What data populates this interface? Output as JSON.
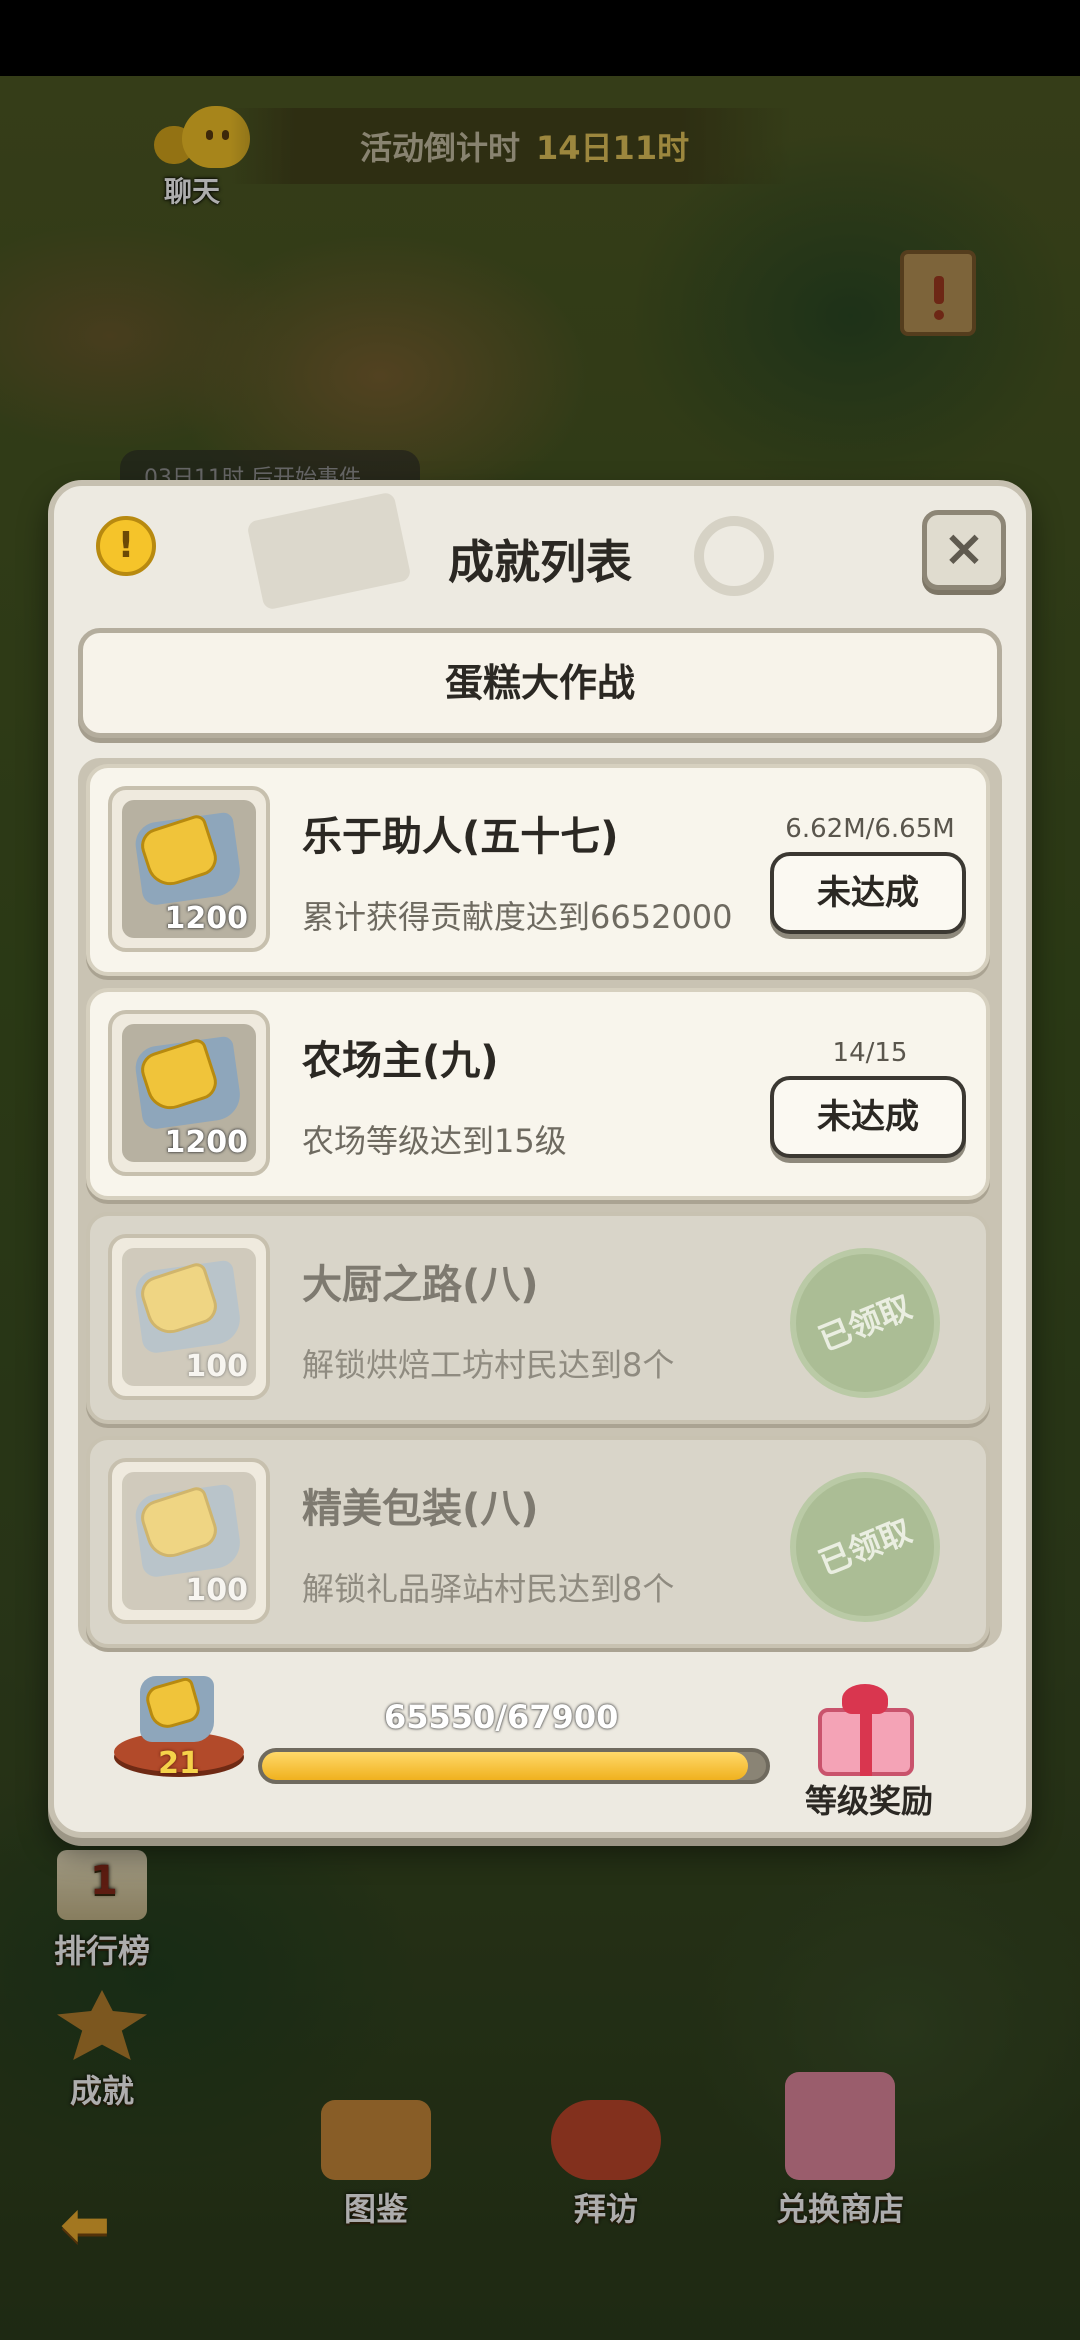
{
  "hud": {
    "chat_label": "聊天",
    "countdown_label": "活动倒计时",
    "countdown_value": "14日11时",
    "event_hint": "03日11时 后开始事件"
  },
  "side_menu": {
    "ranking_label": "排行榜",
    "ranking_icon_number": "1",
    "achievements_label": "成就"
  },
  "bottom_nav": {
    "back_icon": "arrow-left-icon",
    "catalog_label": "图鉴",
    "visit_label": "拜访",
    "shop_label": "兑换商店"
  },
  "dialog": {
    "title": "成就列表",
    "close_glyph": "×",
    "warn_glyph": "!",
    "tab_label": "蛋糕大作战",
    "achievements": [
      {
        "name": "乐于助人(五十七)",
        "desc": "累计获得贡献度达到6652000",
        "reward": "1200",
        "progress": "6.62M/6.65M",
        "status": "未达成",
        "claimed": false
      },
      {
        "name": "农场主(九)",
        "desc": "农场等级达到15级",
        "reward": "1200",
        "progress": "14/15",
        "status": "未达成",
        "claimed": false
      },
      {
        "name": "大厨之路(八)",
        "desc": "解锁烘焙工坊村民达到8个",
        "reward": "100",
        "progress": "",
        "status": "已领取",
        "claimed": true
      },
      {
        "name": "精美包装(八)",
        "desc": "解锁礼品驿站村民达到8个",
        "reward": "100",
        "progress": "",
        "status": "已领取",
        "claimed": true
      }
    ],
    "level": {
      "value": "21",
      "xp_text": "65550/67900",
      "xp_fraction": 0.965,
      "reward_label": "等级奖励"
    }
  },
  "colors": {
    "accent_yellow": "#f0b11e",
    "claimed_green": "#a3b98c",
    "panel": "#edeae1"
  }
}
